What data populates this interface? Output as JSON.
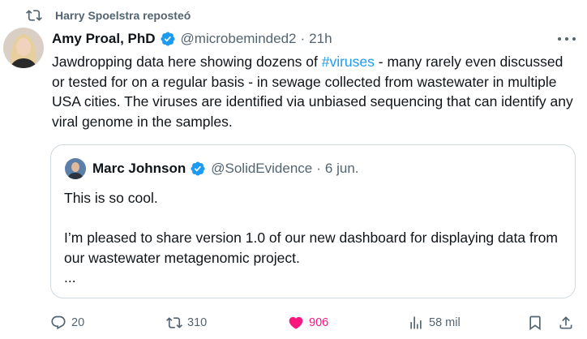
{
  "repost": {
    "label": "Harry Spoelstra reposteó",
    "icon": "repost-icon"
  },
  "tweet": {
    "author_name": "Amy Proal, PhD",
    "handle": "@microbeminded2",
    "separator": "·",
    "time": "21h",
    "text_before": "Jawdropping data here showing dozens of ",
    "hashtag": "#viruses",
    "text_after": " - many rarely even discussed or tested for on a regular basis - in sewage collected from wastewater in multiple USA cities. The viruses are identified via unbiased sequencing that can identify any viral genome in the samples."
  },
  "quote": {
    "author_name": "Marc Johnson",
    "handle": "@SolidEvidence",
    "separator": "·",
    "time": "6 jun.",
    "line1": "This is so cool.",
    "line2": "I’m pleased to share version 1.0 of our new dashboard for displaying data from our wastewater metagenomic project.",
    "line3": "..."
  },
  "actions": {
    "replies": "20",
    "reposts": "310",
    "likes": "906",
    "views": "58 mil"
  },
  "colors": {
    "accent": "#1d9bf0",
    "like": "#f91880",
    "muted": "#536471",
    "text": "#0f1419",
    "border": "#cfd9de"
  }
}
